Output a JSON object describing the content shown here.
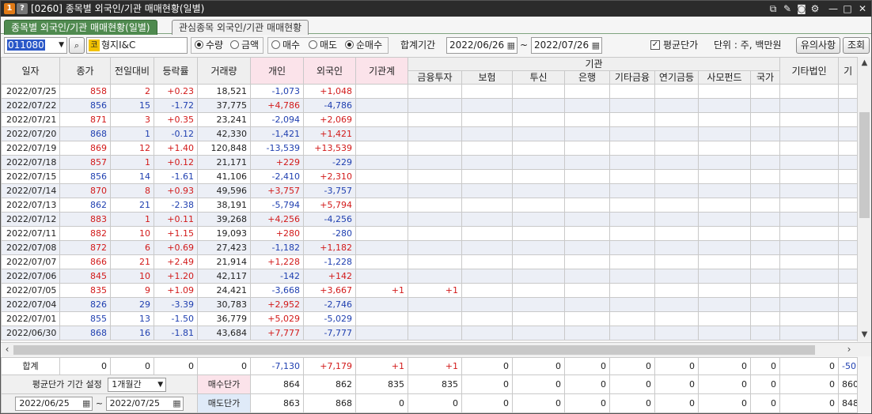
{
  "window": {
    "title": "[0260] 종목별 외국인/기관 매매현황(일별)",
    "badge_1": "1",
    "badge_2": "?"
  },
  "tabs": [
    {
      "label": "종목별 외국인/기관 매매현황(일별)",
      "active": true
    },
    {
      "label": "관심종목 외국인/기관 매매현황",
      "active": false
    }
  ],
  "toolbar": {
    "code": "011080",
    "market_badge": "코",
    "stock_name": "형지I&C",
    "unit_options": [
      "수량",
      "금액"
    ],
    "unit_selected": "수량",
    "trade_options": [
      "매수",
      "매도",
      "순매수"
    ],
    "trade_selected": "순매수",
    "period_label": "합계기간",
    "date_from": "2022/06/26",
    "date_sep": "~",
    "date_to": "2022/07/26",
    "avg_price_label": "평균단가",
    "avg_price_checked": true,
    "unit_text": "단위 : 주, 백만원",
    "notice_button": "유의사항",
    "query_button": "조회"
  },
  "table": {
    "headers": [
      "일자",
      "종가",
      "전일대비",
      "등락률",
      "거래량",
      "개인",
      "외국인",
      "기관계",
      "금융투자",
      "보험",
      "투신",
      "은행",
      "기타금융",
      "연기금등",
      "사모펀드",
      "국가",
      "기타법인",
      "기"
    ],
    "group_header": "기관",
    "rows": [
      [
        "2022/07/25",
        "858",
        "2",
        "+0.23",
        "18,521",
        "-1,073",
        "+1,048",
        "",
        "",
        "",
        "",
        "",
        "",
        "",
        "",
        "",
        "",
        ""
      ],
      [
        "2022/07/22",
        "856",
        "15",
        "-1.72",
        "37,775",
        "+4,786",
        "-4,786",
        "",
        "",
        "",
        "",
        "",
        "",
        "",
        "",
        "",
        "",
        ""
      ],
      [
        "2022/07/21",
        "871",
        "3",
        "+0.35",
        "23,241",
        "-2,094",
        "+2,069",
        "",
        "",
        "",
        "",
        "",
        "",
        "",
        "",
        "",
        "",
        ""
      ],
      [
        "2022/07/20",
        "868",
        "1",
        "-0.12",
        "42,330",
        "-1,421",
        "+1,421",
        "",
        "",
        "",
        "",
        "",
        "",
        "",
        "",
        "",
        "",
        ""
      ],
      [
        "2022/07/19",
        "869",
        "12",
        "+1.40",
        "120,848",
        "-13,539",
        "+13,539",
        "",
        "",
        "",
        "",
        "",
        "",
        "",
        "",
        "",
        "",
        ""
      ],
      [
        "2022/07/18",
        "857",
        "1",
        "+0.12",
        "21,171",
        "+229",
        "-229",
        "",
        "",
        "",
        "",
        "",
        "",
        "",
        "",
        "",
        "",
        ""
      ],
      [
        "2022/07/15",
        "856",
        "14",
        "-1.61",
        "41,106",
        "-2,410",
        "+2,310",
        "",
        "",
        "",
        "",
        "",
        "",
        "",
        "",
        "",
        "",
        ""
      ],
      [
        "2022/07/14",
        "870",
        "8",
        "+0.93",
        "49,596",
        "+3,757",
        "-3,757",
        "",
        "",
        "",
        "",
        "",
        "",
        "",
        "",
        "",
        "",
        ""
      ],
      [
        "2022/07/13",
        "862",
        "21",
        "-2.38",
        "38,191",
        "-5,794",
        "+5,794",
        "",
        "",
        "",
        "",
        "",
        "",
        "",
        "",
        "",
        "",
        ""
      ],
      [
        "2022/07/12",
        "883",
        "1",
        "+0.11",
        "39,268",
        "+4,256",
        "-4,256",
        "",
        "",
        "",
        "",
        "",
        "",
        "",
        "",
        "",
        "",
        ""
      ],
      [
        "2022/07/11",
        "882",
        "10",
        "+1.15",
        "19,093",
        "+280",
        "-280",
        "",
        "",
        "",
        "",
        "",
        "",
        "",
        "",
        "",
        "",
        ""
      ],
      [
        "2022/07/08",
        "872",
        "6",
        "+0.69",
        "27,423",
        "-1,182",
        "+1,182",
        "",
        "",
        "",
        "",
        "",
        "",
        "",
        "",
        "",
        "",
        ""
      ],
      [
        "2022/07/07",
        "866",
        "21",
        "+2.49",
        "21,914",
        "+1,228",
        "-1,228",
        "",
        "",
        "",
        "",
        "",
        "",
        "",
        "",
        "",
        "",
        ""
      ],
      [
        "2022/07/06",
        "845",
        "10",
        "+1.20",
        "42,117",
        "-142",
        "+142",
        "",
        "",
        "",
        "",
        "",
        "",
        "",
        "",
        "",
        "",
        ""
      ],
      [
        "2022/07/05",
        "835",
        "9",
        "+1.09",
        "24,421",
        "-3,668",
        "+3,667",
        "+1",
        "+1",
        "",
        "",
        "",
        "",
        "",
        "",
        "",
        "",
        ""
      ],
      [
        "2022/07/04",
        "826",
        "29",
        "-3.39",
        "30,783",
        "+2,952",
        "-2,746",
        "",
        "",
        "",
        "",
        "",
        "",
        "",
        "",
        "",
        "",
        ""
      ],
      [
        "2022/07/01",
        "855",
        "13",
        "-1.50",
        "36,779",
        "+5,029",
        "-5,029",
        "",
        "",
        "",
        "",
        "",
        "",
        "",
        "",
        "",
        "",
        ""
      ],
      [
        "2022/06/30",
        "868",
        "16",
        "-1.81",
        "43,684",
        "+7,777",
        "-7,777",
        "",
        "",
        "",
        "",
        "",
        "",
        "",
        "",
        "",
        "",
        ""
      ]
    ],
    "row_dir": [
      "up",
      "dn",
      "up",
      "dn",
      "up",
      "up",
      "dn",
      "up",
      "dn",
      "up",
      "up",
      "up",
      "up",
      "up",
      "up",
      "dn",
      "dn",
      "dn"
    ]
  },
  "totals": {
    "sum_label": "합계",
    "sum_values": [
      "0",
      "0",
      "0",
      "0",
      "-7,130",
      "+7,179",
      "+1",
      "+1",
      "0",
      "0",
      "0",
      "0",
      "0",
      "0",
      "0",
      "0",
      "-50"
    ],
    "avg_period_label": "평균단가 기간 설정",
    "avg_period_select": "1개월간",
    "buy_price_label": "매수단가",
    "buy_values": [
      "864",
      "862",
      "835",
      "835",
      "0",
      "0",
      "0",
      "0",
      "0",
      "0",
      "0",
      "0",
      "860"
    ],
    "sell_price_label": "매도단가",
    "sell_values": [
      "863",
      "868",
      "0",
      "0",
      "0",
      "0",
      "0",
      "0",
      "0",
      "0",
      "0",
      "0",
      "848"
    ],
    "avg_from": "2022/06/25",
    "avg_sep": "~",
    "avg_to": "2022/07/25"
  },
  "colors": {
    "up": "#d21a1a",
    "down": "#1f3fb0",
    "tab_active": "#4f8a4f",
    "header_pink": "#fbe3ea",
    "stock_badge": "#f2c200"
  }
}
